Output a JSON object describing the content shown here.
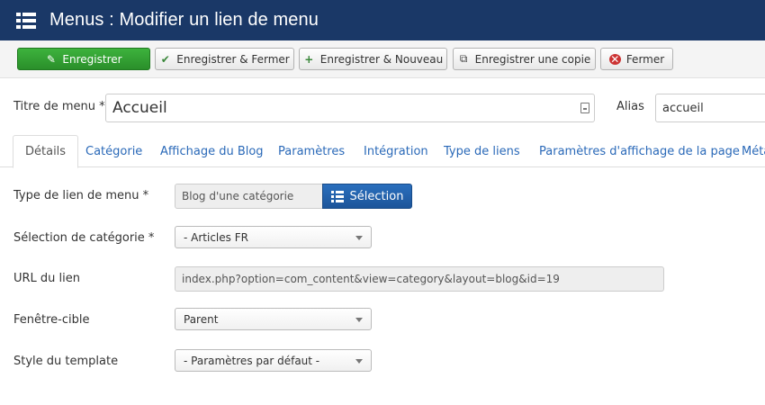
{
  "header": {
    "title": "Menus : Modifier un lien de menu",
    "icon": "list-icon"
  },
  "toolbar": {
    "save": "Enregistrer",
    "save_close": "Enregistrer & Fermer",
    "save_new": "Enregistrer & Nouveau",
    "save_copy": "Enregistrer une copie",
    "close": "Fermer"
  },
  "form": {
    "title_label": "Titre de menu *",
    "title_value": "Accueil",
    "alias_label": "Alias",
    "alias_value": "accueil"
  },
  "tabs": [
    "Détails",
    "Catégorie",
    "Affichage du Blog",
    "Paramètres",
    "Intégration",
    "Type de liens",
    "Paramètres d'affichage de la page",
    "Méta"
  ],
  "details": {
    "type_label": "Type de lien de menu *",
    "type_value": "Blog d'une catégorie",
    "select_button": "Sélection",
    "category_label": "Sélection de catégorie *",
    "category_value": "- Articles FR",
    "url_label": "URL du lien",
    "url_value": "index.php?option=com_content&view=category&layout=blog&id=19",
    "target_label": "Fenêtre-cible",
    "target_value": "Parent",
    "style_label": "Style du template",
    "style_value": "- Paramètres par défaut -"
  },
  "colors": {
    "header_bg": "#1a3867",
    "save_green": "#2f9e2f",
    "select_blue": "#1f5fa8",
    "tab_link": "#2a69b8"
  }
}
